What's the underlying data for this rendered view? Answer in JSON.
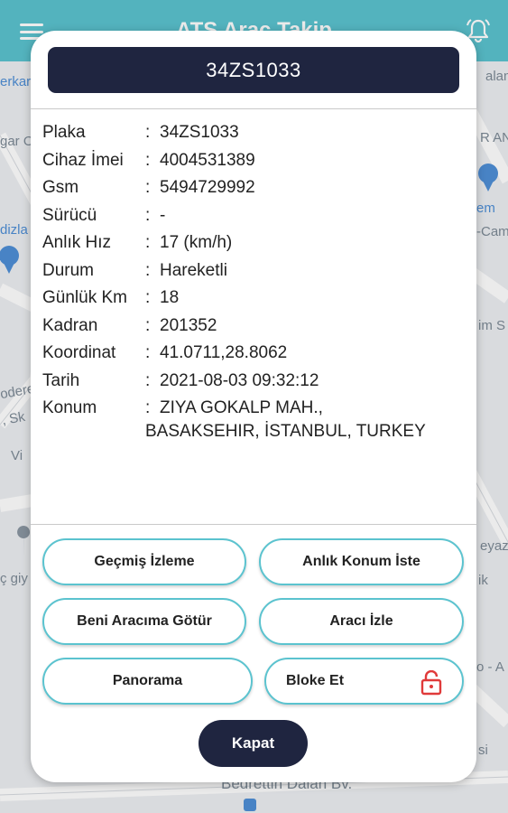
{
  "app": {
    "title": "ATS Araç Takip"
  },
  "map_labels": {
    "left_top": "erkar",
    "left_2": "gar O",
    "left_3": "dizla",
    "left_4": "odere",
    "left_5": ", Sk",
    "left_6": "Vi",
    "left_7": "ç giy",
    "right_top": "alan",
    "right_2": "R AN",
    "right_3": "em",
    "right_4": "-Cam",
    "right_5": "im S",
    "right_6": "eyaz",
    "right_7": "ik",
    "right_8": "o - A",
    "right_9": "si",
    "bottom_street": "Bedrettin Dalan Bv."
  },
  "vehicle": {
    "plate_title": "34ZS1033",
    "fields": [
      {
        "label": "Plaka",
        "value": "34ZS1033"
      },
      {
        "label": "Cihaz İmei",
        "value": "4004531389"
      },
      {
        "label": "Gsm",
        "value": "5494729992"
      },
      {
        "label": "Sürücü",
        "value": "-"
      },
      {
        "label": "Anlık Hız",
        "value": "17 (km/h)"
      },
      {
        "label": "Durum",
        "value": "Hareketli"
      },
      {
        "label": "Günlük Km",
        "value": "18"
      },
      {
        "label": "Kadran",
        "value": "201352"
      },
      {
        "label": "Koordinat",
        "value": "41.0711,28.8062"
      },
      {
        "label": "Tarih",
        "value": "2021-08-03 09:32:12"
      },
      {
        "label": "Konum",
        "value": "ZIYA GOKALP MAH.,",
        "value_line2": "BASAKSEHIR, İSTANBUL, TURKEY"
      }
    ],
    "separator": ":"
  },
  "actions": {
    "history": "Geçmiş İzleme",
    "request_location": "Anlık Konum İste",
    "take_me": "Beni Aracıma Götür",
    "track": "Aracı İzle",
    "panorama": "Panorama",
    "block": "Bloke Et",
    "close": "Kapat"
  },
  "colors": {
    "accent": "#5bc3cf",
    "dark": "#1f2540",
    "lock": "#e03a3a"
  },
  "icons": {
    "menu": "hamburger-menu-icon",
    "notification": "bell-icon",
    "lock": "unlocked-padlock-icon"
  }
}
